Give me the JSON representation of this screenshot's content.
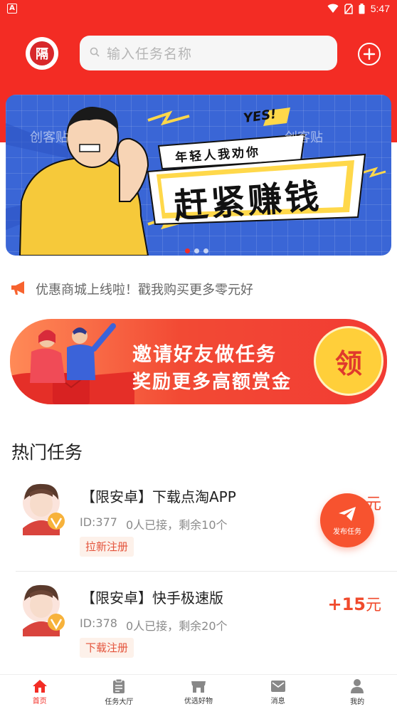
{
  "status_bar": {
    "time": "5:47",
    "notification_icon": "A"
  },
  "header": {
    "logo_char": "隔",
    "search_placeholder": "输入任务名称"
  },
  "banner": {
    "yes": "YES!",
    "line1": "年轻人我劝你",
    "line2": "赶紧赚钱",
    "watermark": "创客贴"
  },
  "notice": {
    "text": "优惠商城上线啦！戳我购买更多零元好"
  },
  "invite": {
    "line1": "邀请好友做任务",
    "line2": "奖励更多高额赏金",
    "button": "领"
  },
  "section": {
    "title": "热门任务"
  },
  "tasks": [
    {
      "title": "【限安卓】下载点淘APP",
      "id": "ID:377",
      "taken": "0人已接，",
      "remaining": "剩余10个",
      "tag": "拉新注册",
      "reward": "+",
      "unit": "元"
    },
    {
      "title": "【限安卓】快手极速版",
      "id": "ID:378",
      "taken": "0人已接，",
      "remaining": "剩余20个",
      "tag": "下载注册",
      "reward": "+15",
      "unit": "元"
    }
  ],
  "fab": {
    "label": "发布任务"
  },
  "nav": [
    {
      "label": "首页",
      "icon": "home-icon"
    },
    {
      "label": "任务大厅",
      "icon": "clipboard-icon"
    },
    {
      "label": "优选好物",
      "icon": "store-icon"
    },
    {
      "label": "消息",
      "icon": "message-icon"
    },
    {
      "label": "我的",
      "icon": "user-icon"
    }
  ],
  "colors": {
    "brand_red": "#f32c24",
    "accent_orange": "#f7532f",
    "gold": "#ffcf3a"
  }
}
